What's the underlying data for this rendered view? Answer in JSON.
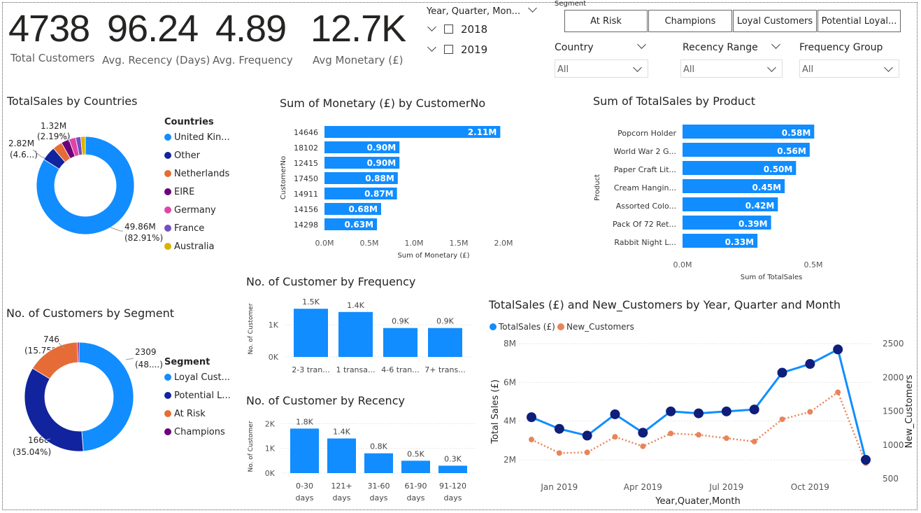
{
  "kpis": [
    {
      "value": "4738",
      "label": "Total Customers"
    },
    {
      "value": "96.24",
      "label": "Avg. Recency (Days)"
    },
    {
      "value": "4.89",
      "label": "Avg. Frequency"
    },
    {
      "value": "12.7K",
      "label": "Avg Monetary (£)"
    }
  ],
  "date_slicer": {
    "title": "Year, Quarter, Mon...",
    "items": [
      "2018",
      "2019"
    ]
  },
  "segment_slicer": {
    "title": "Segment",
    "tiles": [
      "At Risk",
      "Champions",
      "Loyal Customers",
      "Potential Loyal..."
    ]
  },
  "dropdowns": [
    {
      "title": "Country",
      "value": "All"
    },
    {
      "title": "Recency Range",
      "value": "All"
    },
    {
      "title": "Frequency Group",
      "value": "All"
    }
  ],
  "colors": {
    "blue": "#118dff",
    "navy": "#12239e",
    "orange": "#e66c37",
    "purple": "#6b007b",
    "pink": "#e044a7",
    "violet": "#744ec2",
    "gold": "#d9b300",
    "line_orange": "#e8845a",
    "marker_navy": "#0e1e7a"
  },
  "countries_chart": {
    "title": "TotalSales by Countries",
    "legend_title": "Countries",
    "legend": [
      "United Kin...",
      "Other",
      "Netherlands",
      "EIRE",
      "Germany",
      "France",
      "Australia"
    ],
    "labels": {
      "main_value": "49.86M",
      "main_pct": "(82.91%)",
      "l1_value": "1.32M",
      "l1_pct": "(2.19%)",
      "l2_value": "2.82M",
      "l2_pct": "(4.6...)"
    }
  },
  "segment_chart": {
    "title": "No. of Customers by Segment",
    "legend_title": "Segment",
    "legend": [
      "Loyal Cust...",
      "Potential L...",
      "At Risk",
      "Champions"
    ],
    "labels": {
      "a_value": "2309",
      "a_pct": "(48....)",
      "b_value": "1660",
      "b_pct": "(35.04%)",
      "c_value": "746",
      "c_pct": "(15.75%)"
    }
  },
  "chart_data": [
    {
      "type": "pie",
      "title": "TotalSales by Countries",
      "legend_title": "Countries",
      "categories": [
        "United Kin...",
        "Other",
        "Netherlands",
        "EIRE",
        "Germany",
        "France",
        "Australia"
      ],
      "values": [
        49.86,
        2.82,
        1.9,
        1.6,
        1.32,
        1.0,
        0.9
      ],
      "unit": "M"
    },
    {
      "type": "pie",
      "title": "No. of Customers by Segment",
      "legend_title": "Segment",
      "categories": [
        "Loyal Cust...",
        "Potential L...",
        "At Risk",
        "Champions"
      ],
      "values": [
        2309,
        1660,
        746,
        23
      ]
    },
    {
      "type": "bar",
      "orientation": "horizontal",
      "title": "Sum of Monetary (£) by CustomerNo",
      "xlabel": "Sum of Monetary (£)",
      "ylabel": "CustomerNo",
      "categories": [
        "14646",
        "18102",
        "12415",
        "17450",
        "14911",
        "14156",
        "14298"
      ],
      "values": [
        2.11,
        0.9,
        0.9,
        0.88,
        0.87,
        0.68,
        0.63
      ],
      "value_labels": [
        "2.11M",
        "0.90M",
        "0.90M",
        "0.88M",
        "0.87M",
        "0.68M",
        "0.63M"
      ],
      "xticks": [
        "0.0M",
        "0.5M",
        "1.0M",
        "1.5M",
        "2.0M"
      ],
      "xlim": [
        0,
        2.3
      ]
    },
    {
      "type": "bar",
      "orientation": "horizontal",
      "title": "Sum of TotalSales by Product",
      "xlabel": "Sum of TotalSales",
      "ylabel": "Product",
      "categories": [
        "Popcorn Holder",
        "World War 2 G...",
        "Paper Craft Lit...",
        "Cream Hangin...",
        "Assorted Colo...",
        "Pack Of 72 Ret...",
        "Rabbit Night L..."
      ],
      "values": [
        0.58,
        0.56,
        0.5,
        0.45,
        0.42,
        0.39,
        0.33
      ],
      "value_labels": [
        "0.58M",
        "0.56M",
        "0.50M",
        "0.45M",
        "0.42M",
        "0.39M",
        "0.33M"
      ],
      "xticks": [
        "0.0M",
        "0.5M"
      ],
      "xlim": [
        0,
        0.73
      ]
    },
    {
      "type": "bar",
      "title": "No. of Customer by Frequency",
      "ylabel": "No. of Customer",
      "categories": [
        "2-3 tran...",
        "1 transa...",
        "4-6 tran...",
        "7+ trans..."
      ],
      "values": [
        1500,
        1400,
        900,
        900
      ],
      "value_labels": [
        "1.5K",
        "1.4K",
        "0.9K",
        "0.9K"
      ],
      "yticks": [
        "0K",
        "1K"
      ],
      "ylim": [
        0,
        1700
      ]
    },
    {
      "type": "bar",
      "title": "No. of Customer by Recency",
      "ylabel": "No. of Customer",
      "categories": [
        "0-30 days",
        "121+ days",
        "31-60 days",
        "61-90 days",
        "91-120 days"
      ],
      "values": [
        1800,
        1400,
        800,
        500,
        300
      ],
      "value_labels": [
        "1.8K",
        "1.4K",
        "0.8K",
        "0.5K",
        "0.3K"
      ],
      "yticks": [
        "0K",
        "1K",
        "2K"
      ],
      "ylim": [
        0,
        2150
      ]
    },
    {
      "type": "line",
      "title": "TotalSales (£) and New_Customers by Year, Quarter and Month",
      "xlabel": "Year,Quater,Month",
      "ylabel": "Total Sales (£)",
      "ylabel_right": "New_Customers",
      "x": [
        "2018-12",
        "2019-01",
        "2019-02",
        "2019-03",
        "2019-04",
        "2019-05",
        "2019-06",
        "2019-07",
        "2019-08",
        "2019-09",
        "2019-10",
        "2019-11",
        "2019-12"
      ],
      "xticks": [
        "Jan 2019",
        "Apr 2019",
        "Jul 2019",
        "Oct 2019"
      ],
      "yticks_left": [
        "2M",
        "4M",
        "6M",
        "8M"
      ],
      "yticks_right": [
        "500",
        "1000",
        "1500",
        "2000",
        "2500"
      ],
      "ylim_left": [
        1.6,
        8.5
      ],
      "ylim_right": [
        500,
        2600
      ],
      "series": [
        {
          "name": "TotalSales (£)",
          "axis": "left",
          "values": [
            4.2,
            3.6,
            3.25,
            4.35,
            3.4,
            4.5,
            4.4,
            4.5,
            4.6,
            6.5,
            6.95,
            7.7,
            2.0
          ]
        },
        {
          "name": "New_Customers",
          "axis": "right",
          "values": [
            1080,
            880,
            890,
            1120,
            980,
            1170,
            1150,
            1100,
            1050,
            1380,
            1490,
            1780,
            730
          ]
        }
      ]
    }
  ]
}
